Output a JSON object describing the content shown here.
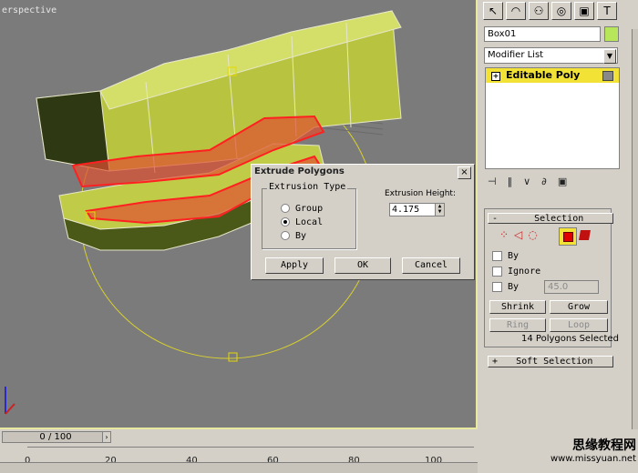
{
  "viewport": {
    "label": "erspective"
  },
  "dialog": {
    "title": "Extrude Polygons",
    "close": "×",
    "group_title": "Extrusion Type",
    "options": [
      "Group",
      "Local",
      "By"
    ],
    "selected_option": "Local",
    "height_label": "Extrusion Height:",
    "height_value": "4.175",
    "apply": "Apply",
    "ok": "OK",
    "cancel": "Cancel"
  },
  "panel": {
    "object_name": "Box01",
    "object_color": "#b8e65a",
    "modifier_list": "Modifier List",
    "stack_item": "Editable Poly",
    "selection_title": "Selection",
    "checkbox_by": "By",
    "checkbox_ignore": "Ignore",
    "checkbox_by2": "By",
    "angle_value": "45.0",
    "shrink": "Shrink",
    "grow": "Grow",
    "ring": "Ring",
    "loop": "Loop",
    "status": "14 Polygons Selected",
    "soft_selection_title": "Soft Selection",
    "plus": "+",
    "minus": "-"
  },
  "timeline": {
    "slider": "0 / 100",
    "ruler_labels": [
      "0",
      "20",
      "40",
      "60",
      "80",
      "100"
    ]
  },
  "watermark": {
    "line1": "思缘教程网",
    "line2": "www.missyuan.net"
  }
}
